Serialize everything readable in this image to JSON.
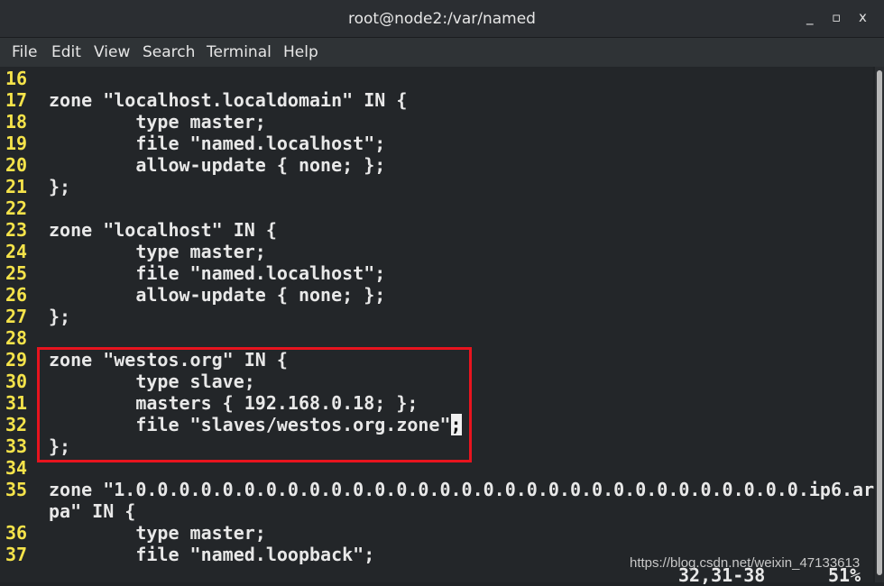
{
  "window": {
    "title": "root@node2:/var/named",
    "minimize": "_",
    "maximize": "▫",
    "close": "x"
  },
  "menu": [
    "File",
    "Edit",
    "View",
    "Search",
    "Terminal",
    "Help"
  ],
  "lines": [
    {
      "num": "16",
      "text": ""
    },
    {
      "num": "17",
      "text": "zone \"localhost.localdomain\" IN {"
    },
    {
      "num": "18",
      "text": "        type master;"
    },
    {
      "num": "19",
      "text": "        file \"named.localhost\";"
    },
    {
      "num": "20",
      "text": "        allow-update { none; };"
    },
    {
      "num": "21",
      "text": "};"
    },
    {
      "num": "22",
      "text": ""
    },
    {
      "num": "23",
      "text": "zone \"localhost\" IN {"
    },
    {
      "num": "24",
      "text": "        type master;"
    },
    {
      "num": "25",
      "text": "        file \"named.localhost\";"
    },
    {
      "num": "26",
      "text": "        allow-update { none; };"
    },
    {
      "num": "27",
      "text": "};"
    },
    {
      "num": "28",
      "text": ""
    },
    {
      "num": "29",
      "text": "zone \"westos.org\" IN {"
    },
    {
      "num": "30",
      "text": "        type slave;"
    },
    {
      "num": "31",
      "text": "        masters { 192.168.0.18; };"
    },
    {
      "num": "32",
      "text": "        file \"slaves/westos.org.zone\"",
      "cursor": ";"
    },
    {
      "num": "33",
      "text": "};"
    },
    {
      "num": "34",
      "text": ""
    },
    {
      "num": "35",
      "text": "zone \"1.0.0.0.0.0.0.0.0.0.0.0.0.0.0.0.0.0.0.0.0.0.0.0.0.0.0.0.0.0.0.0.ip6.ar"
    },
    {
      "num": "",
      "text": "pa\" IN {"
    },
    {
      "num": "36",
      "text": "        type master;"
    },
    {
      "num": "37",
      "text": "        file \"named.loopback\";"
    }
  ],
  "status": {
    "position": "32,31-38",
    "percent": "51%"
  },
  "watermark": "https://blog.csdn.net/weixin_47133613",
  "colors": {
    "line_numbers": "#f5e34a",
    "highlight_box": "#e8141e",
    "background": "#232629"
  }
}
